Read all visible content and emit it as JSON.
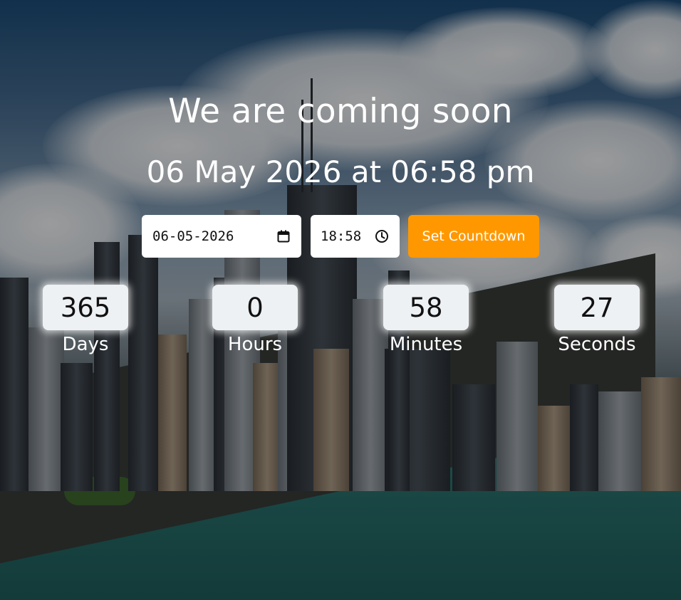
{
  "page": {
    "title": "We are coming soon",
    "target_label": "06 May 2026 at 06:58 pm"
  },
  "form": {
    "date_value": "06-05-2026",
    "time_value": "18:58",
    "submit_label": "Set Countdown",
    "date_icon": "calendar-icon",
    "time_icon": "clock-icon",
    "accent_color": "#ff9800"
  },
  "countdown": [
    {
      "value": "365",
      "label": "Days"
    },
    {
      "value": "0",
      "label": "Hours"
    },
    {
      "value": "58",
      "label": "Minutes"
    },
    {
      "value": "27",
      "label": "Seconds"
    }
  ]
}
